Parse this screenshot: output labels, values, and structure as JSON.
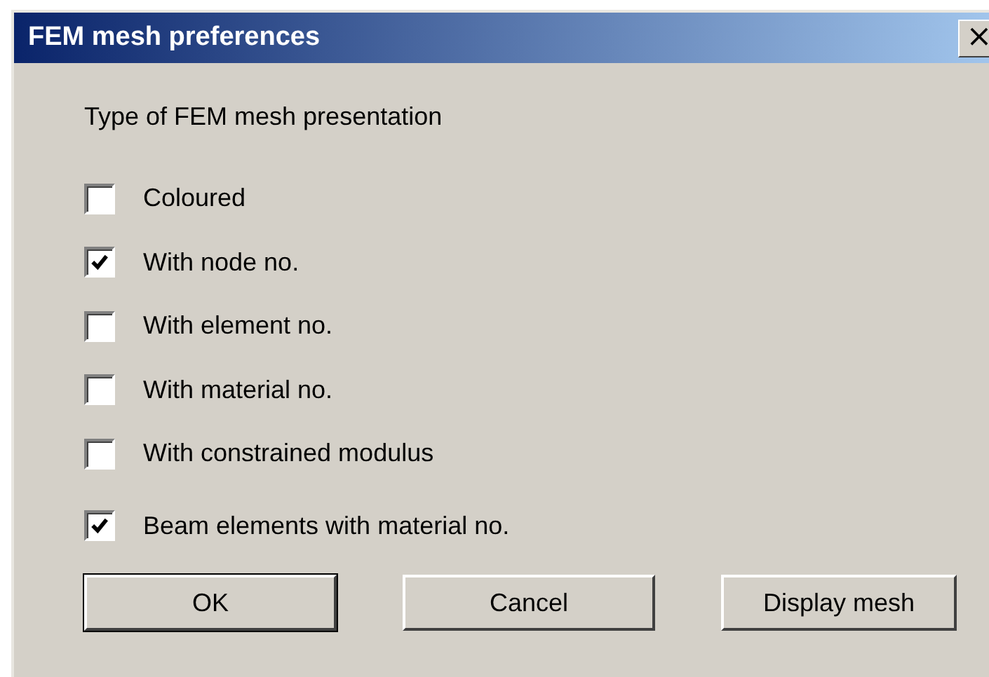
{
  "window": {
    "title": "FEM mesh preferences",
    "close": "×"
  },
  "group_label": "Type of FEM mesh presentation",
  "options": [
    {
      "label": "Coloured",
      "checked": false
    },
    {
      "label": "With node no.",
      "checked": true
    },
    {
      "label": "With element no.",
      "checked": false
    },
    {
      "label": "With material no.",
      "checked": false
    },
    {
      "label": "With constrained modulus",
      "checked": false
    },
    {
      "label": "Beam elements with material no.",
      "checked": true
    }
  ],
  "buttons": [
    {
      "label": "OK",
      "default": true
    },
    {
      "label": "Cancel",
      "default": false
    },
    {
      "label": "Display mesh",
      "default": false
    }
  ]
}
